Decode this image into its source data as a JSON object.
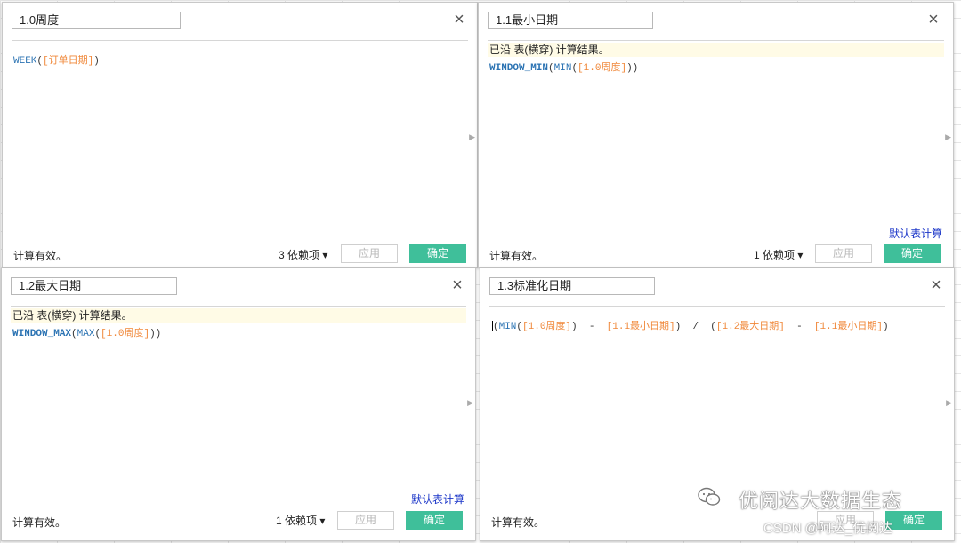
{
  "dialogs": [
    {
      "title": "1.0周度",
      "formula": {
        "fn": "WEEK",
        "field": "[订单日期]"
      },
      "status": "计算有效。",
      "dependencies": "3 依赖项",
      "apply": "应用",
      "ok": "确定"
    },
    {
      "title": "1.1最小日期",
      "note": "已沿 表(横穿) 计算结果。",
      "formula": {
        "outer": "WINDOW_MIN",
        "inner": "MIN",
        "field": "[1.0周度]"
      },
      "default_link": "默认表计算",
      "status": "计算有效。",
      "dependencies": "1 依赖项",
      "apply": "应用",
      "ok": "确定"
    },
    {
      "title": "1.2最大日期",
      "note": "已沿 表(横穿) 计算结果。",
      "formula": {
        "outer": "WINDOW_MAX",
        "inner": "MAX",
        "field": "[1.0周度]"
      },
      "default_link": "默认表计算",
      "status": "计算有效。",
      "dependencies": "1 依赖项",
      "apply": "应用",
      "ok": "确定"
    },
    {
      "title": "1.3标准化日期",
      "formula": {
        "fn": "MIN",
        "f1": "[1.0周度]",
        "f2": "[1.1最小日期]",
        "f3": "[1.2最大日期]",
        "f4": "[1.1最小日期]"
      },
      "status": "计算有效。",
      "apply": "应用",
      "ok": "确定"
    }
  ],
  "watermark": {
    "brand": "优阅达大数据生态",
    "csdn": "CSDN @阿达_优阅达"
  },
  "colors": {
    "ok_button": "#3fbf9a",
    "link": "#1a35c8",
    "function": "#2b73b3",
    "field": "#f0883a"
  }
}
